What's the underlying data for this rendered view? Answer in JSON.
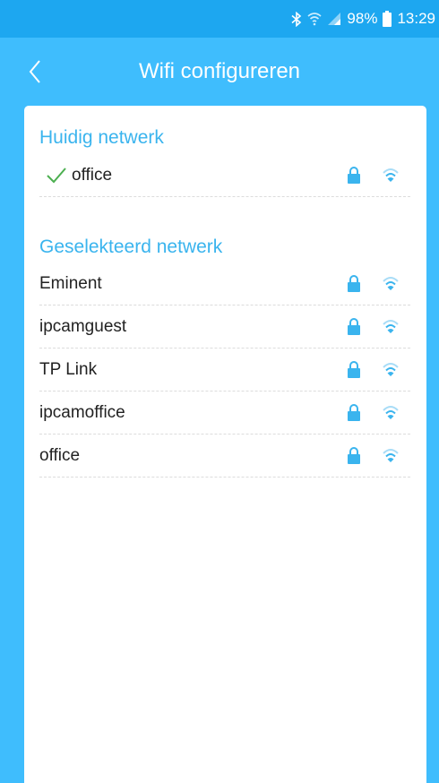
{
  "status_bar": {
    "icons": [
      "bluetooth-icon",
      "wifi-status-icon",
      "signal-icon",
      "battery-icon"
    ],
    "battery": "98%",
    "time": "13:29"
  },
  "header": {
    "back_icon": "chevron-left-icon",
    "title": "Wifi configureren"
  },
  "current": {
    "section_title": "Huidig netwerk",
    "network": {
      "name": "office",
      "connected": true,
      "secured": true
    }
  },
  "selected": {
    "section_title": "Geselekteerd netwerk",
    "networks": [
      {
        "name": "Eminent",
        "secured": true
      },
      {
        "name": "ipcamguest",
        "secured": true
      },
      {
        "name": "TP Link",
        "secured": true
      },
      {
        "name": "ipcamoffice",
        "secured": true
      },
      {
        "name": "office",
        "secured": true
      }
    ]
  },
  "colors": {
    "background": "#3fbdfd",
    "status_bar": "#1da7f0",
    "accent": "#3ab4ee",
    "check": "#4caf50"
  }
}
